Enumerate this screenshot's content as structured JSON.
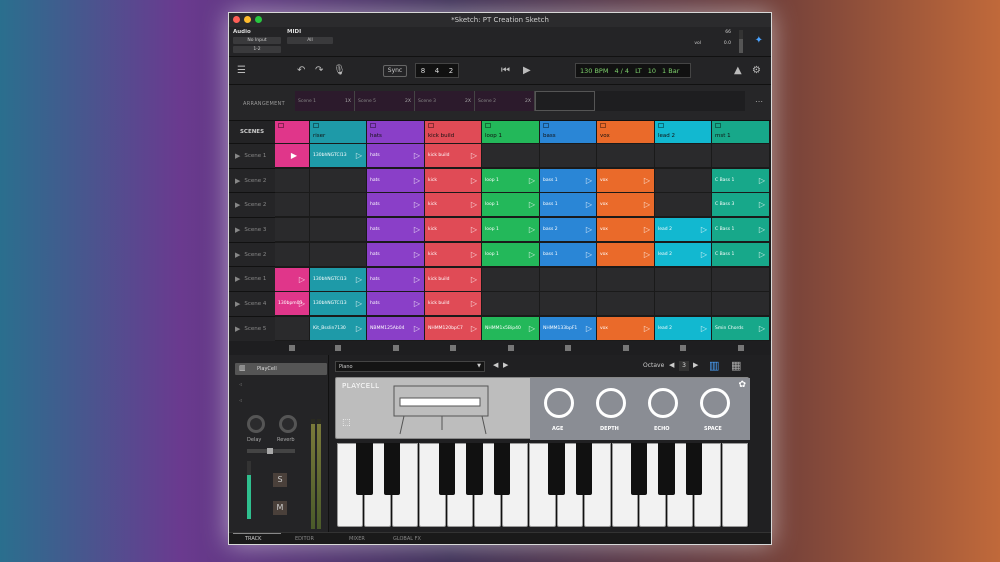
{
  "window": {
    "title": "*Sketch: PT Creation Sketch"
  },
  "io": {
    "audio_label": "Audio",
    "audio_input": "No Input",
    "audio_channel": "1-2",
    "midi_label": "MIDI",
    "midi_input": "All",
    "meter_value": "66",
    "vol_label": "vol",
    "vol_value": "0.0"
  },
  "transport": {
    "sync": "Sync",
    "position": [
      "8",
      "4",
      "2"
    ],
    "tempo": "130 BPM",
    "meter": "4 / 4",
    "lt": "LT",
    "lt_value": "10",
    "count_in": "1 Bar"
  },
  "arrangement": {
    "label": "ARRANGEMENT",
    "segments": [
      {
        "name": "Scene 1",
        "repeat": "1X"
      },
      {
        "name": "Scene 5",
        "repeat": "2X"
      },
      {
        "name": "Scene 3",
        "repeat": "2X"
      },
      {
        "name": "Scene 2",
        "repeat": "2X"
      }
    ]
  },
  "scenes": {
    "header": "SCENES",
    "items": [
      "Scene 1",
      "Scene 2",
      "Scene 2",
      "Scene 3",
      "Scene 2",
      "Scene 1",
      "Scene 4",
      "Scene 5"
    ]
  },
  "tracks": [
    {
      "name": "",
      "color": "#e0368a"
    },
    {
      "name": "riser",
      "color": "#1e9aa8"
    },
    {
      "name": "hats",
      "color": "#8a3fc8"
    },
    {
      "name": "kick build",
      "color": "#e04b56"
    },
    {
      "name": "loop 1",
      "color": "#23b85a"
    },
    {
      "name": "bass",
      "color": "#2a86d6"
    },
    {
      "name": "vox",
      "color": "#ea6a2a"
    },
    {
      "name": "lead 2",
      "color": "#12b8d0"
    },
    {
      "name": "mst 1",
      "color": "#17a88a"
    }
  ],
  "clips": [
    [
      {
        "t": "",
        "play": true,
        "active": true
      },
      {
        "t": "130bhNGTCl13",
        "play": true
      },
      {
        "t": "hats",
        "play": true
      },
      {
        "t": "kick build",
        "play": true
      },
      null,
      null,
      null,
      null,
      null
    ],
    [
      null,
      null,
      {
        "t": "hats",
        "play": true
      },
      {
        "t": "kick",
        "play": true
      },
      {
        "t": "loop 1",
        "play": true
      },
      {
        "t": "bass 1",
        "play": true
      },
      {
        "t": "vox",
        "play": true
      },
      null,
      {
        "t": "C Bass 1",
        "play": true
      }
    ],
    [
      null,
      null,
      {
        "t": "hats",
        "play": true
      },
      {
        "t": "kick",
        "play": true
      },
      {
        "t": "loop 1",
        "play": true
      },
      {
        "t": "bass 1",
        "play": true
      },
      {
        "t": "vox",
        "play": true
      },
      null,
      {
        "t": "C Bass 3",
        "play": true
      }
    ],
    [
      null,
      null,
      {
        "t": "hats",
        "play": true
      },
      {
        "t": "kick",
        "play": true
      },
      {
        "t": "loop 1",
        "play": true
      },
      {
        "t": "bass 2",
        "play": true
      },
      {
        "t": "vox",
        "play": true
      },
      {
        "t": "lead 2",
        "play": true
      },
      {
        "t": "C Bass 1",
        "play": true
      }
    ],
    [
      null,
      null,
      {
        "t": "hats",
        "play": true
      },
      {
        "t": "kick",
        "play": true
      },
      {
        "t": "loop 1",
        "play": true
      },
      {
        "t": "bass 1",
        "play": true
      },
      {
        "t": "vox",
        "play": true
      },
      {
        "t": "lead 2",
        "play": true
      },
      {
        "t": "C Bass 1",
        "play": true
      }
    ],
    [
      {
        "t": "",
        "play": true
      },
      {
        "t": "130bhNGTCl13",
        "play": true
      },
      {
        "t": "hats",
        "play": true
      },
      {
        "t": "kick build",
        "play": true
      },
      null,
      null,
      null,
      null,
      null
    ],
    [
      {
        "t": "130bpm03",
        "play": true
      },
      {
        "t": "130bhNGTCl13",
        "play": true
      },
      {
        "t": "hats",
        "play": true
      },
      {
        "t": "kick build",
        "play": true
      },
      null,
      null,
      null,
      null,
      null
    ],
    [
      null,
      {
        "t": "Kit_Bsslin7130",
        "play": true
      },
      {
        "t": "NBMM125Ab04",
        "play": true
      },
      {
        "t": "NHMM120bpC7",
        "play": true
      },
      {
        "t": "NHMM1x5Bip40",
        "play": true
      },
      {
        "t": "NHMM133bpF1",
        "play": true
      },
      {
        "t": "vox",
        "play": true
      },
      {
        "t": "lead 2",
        "play": true
      },
      {
        "t": "Smin Chords",
        "play": true
      }
    ]
  ],
  "track_panel": {
    "instrument": "PlayCell",
    "delay": "Delay",
    "reverb": "Reverb",
    "solo": "S",
    "mute": "M"
  },
  "instrument": {
    "preset": "Piano",
    "octave_label": "Octave",
    "octave_value": "3",
    "plugin_name": "PLAYCELL",
    "knobs": [
      "AGE",
      "DEPTH",
      "ECHO",
      "SPACE"
    ]
  },
  "bottom_tabs": [
    "TRACK",
    "EDITOR",
    "MIXER",
    "GLOBAL FX"
  ],
  "colors": {
    "accent": "#4aa3ff",
    "lcd": "#7fd36d"
  }
}
